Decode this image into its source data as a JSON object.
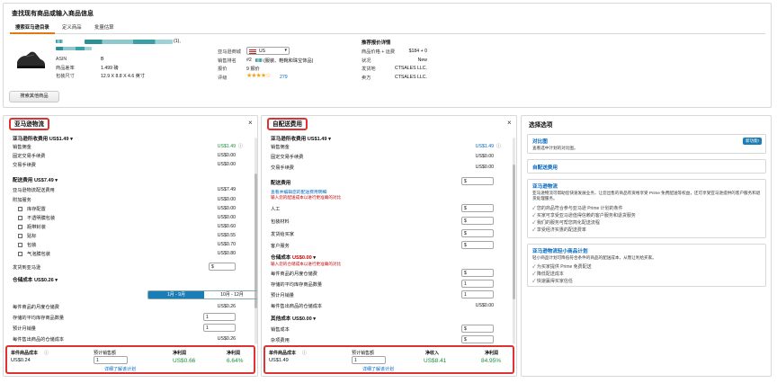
{
  "page_title": "查找现有商品或输入商品信息",
  "tabs": [
    "搜索亚马逊目录",
    "定义商品",
    "批量估算"
  ],
  "product": {
    "title_suffix": "(1),",
    "asin_label": "ASIN",
    "asin_value": "B",
    "category_label": "商品差率",
    "category_value": "1.499 磅",
    "dims_label": "包装尺寸",
    "dims_value": "12.9 X 8.8 X 4.6 英寸",
    "marketplace_label": "亚马逊商城",
    "marketplace_value": "US",
    "rank_label": "销售排名",
    "rank_value": "#2",
    "rank_category": "(服装、鞋靴和珠宝饰品)",
    "offers_label": "报价",
    "offers_value": "9 报价",
    "rating_label": "评级",
    "rating_stars": "★★★★☆",
    "rating_count": "279",
    "search_other": "搜索其他商品"
  },
  "offer": {
    "heading": "推荐报价详情",
    "price_label": "商品价格 + 运费",
    "price_value": "$184 + 0",
    "condition_label": "状况",
    "condition_value": "New",
    "seller_label": "发货地",
    "seller_value": "CTSALES LLC.",
    "buybox_label": "卖方",
    "buybox_value": "CTSALES LLC."
  },
  "fba": {
    "title": "亚马逊物流",
    "fees_title": "亚马逊所收费用",
    "fees_total": "US$1.49",
    "rows1": [
      {
        "label": "销售佣金",
        "value": "US$1.49",
        "info": true
      },
      {
        "label": "固定交易手续费",
        "value": "US$0.00"
      },
      {
        "label": "交易手续费",
        "value": "US$0.00"
      }
    ],
    "ship_title": "配送费用",
    "ship_total": "US$7.49",
    "rows2": [
      {
        "label": "亚马逊物流配送费用",
        "value": "US$7.49"
      },
      {
        "label": "附加服务",
        "value": "US$0.00"
      }
    ],
    "services": [
      {
        "label": "库存配置",
        "value": "US$0.00"
      },
      {
        "label": "不透明膜包装",
        "value": "US$0.00"
      },
      {
        "label": "瓶带封装",
        "value": "US$0.60"
      },
      {
        "label": "贴标",
        "value": "US$0.55"
      },
      {
        "label": "包装",
        "value": "US$0.70"
      },
      {
        "label": "气泡膜包装",
        "value": "US$0.80"
      }
    ],
    "inbound_label": "发货到亚马逊",
    "inbound_value": "$",
    "storage_title": "仓储成本",
    "storage_total": "US$0.26",
    "period_a": "1月 - 9月",
    "period_b": "10月 - 12月",
    "rows3": [
      {
        "label": "每件商品的月度仓储费",
        "value": "US$0.26"
      },
      {
        "label": "存储的平均库存商品数量",
        "value": "1"
      },
      {
        "label": "预计月销量",
        "value": "1"
      },
      {
        "label": "每件售出商品的仓储成本",
        "value": "US$0.26"
      }
    ],
    "footer": {
      "cost_label": "单件商品成本",
      "cost_value": "US$0.24",
      "qty_label": "预计销售额",
      "qty_value": "1",
      "net_label": "净利润",
      "net_value": "US$0.66",
      "margin_label": "净利润",
      "margin_value": "6.64%",
      "more_link": "详细了解该计划"
    }
  },
  "mfn": {
    "title": "自配送费用",
    "fees_title": "亚马逊所收费用",
    "fees_total": "US$1.49",
    "rows1": [
      {
        "label": "销售佣金",
        "value": "US$1.49",
        "info": true
      },
      {
        "label": "固定交易手续费",
        "value": "US$0.00"
      },
      {
        "label": "交易手续费",
        "value": "US$0.00"
      }
    ],
    "ship_title": "配送费用",
    "ship_input": "$",
    "ship_link": "查看并编辑您的配送费用明细",
    "ship_note": "输入您的配送成本以进行更准确的对比",
    "rows2": [
      {
        "label": "人工",
        "value": "$"
      },
      {
        "label": "包装材料",
        "value": "$"
      },
      {
        "label": "发货给买家",
        "value": "$"
      },
      {
        "label": "客户服务",
        "value": "$"
      }
    ],
    "storage_title": "仓储成本",
    "storage_total": "US$0.00",
    "storage_note": "输入您的仓储成本以进行更准确的对比",
    "rows3": [
      {
        "label": "每件商品的月度仓储费",
        "value": "$"
      },
      {
        "label": "存储的平均库存商品数量",
        "value": "1"
      },
      {
        "label": "预计月销量",
        "value": "1"
      },
      {
        "label": "每件售出商品的仓储成本",
        "value": "US$0.00"
      }
    ],
    "other_title": "其他成本",
    "other_total": "US$0.00",
    "rows4": [
      {
        "label": "销售成本",
        "value": "$"
      },
      {
        "label": "杂项费用",
        "value": "$"
      }
    ],
    "footer": {
      "cost_label": "单件商品成本",
      "cost_value": "US$1.49",
      "qty_label": "预计销售额",
      "qty_value": "1",
      "net_label": "净收入",
      "net_value": "US$8.41",
      "margin_label": "净利润",
      "margin_value": "84.95%",
      "more_link": "详细了解该计划"
    }
  },
  "options": {
    "title": "选择选项",
    "compare": {
      "title": "对比图",
      "desc": "查看选中计划的对比图。",
      "badge": "新功能!"
    },
    "mfn_card": {
      "title": "自配送费用"
    },
    "fba_card": {
      "title": "亚马逊物流",
      "desc": "亚马逊物流可帮助您快速发展业务，让您出售的商品有资格享受 Prime 免费配送等权益，还可享受亚马逊提供的客户服务和退货处理服务。",
      "checks": [
        "您的商品符合参与亚马逊 Prime 计划的条件",
        "买家可享受亚马逊值得信赖的客户服务和退货服务",
        "我们的服务可帮您简化配送流程",
        "享受经济实惠的配送费率"
      ]
    },
    "small_card": {
      "title": "亚马逊物流轻小商品计划",
      "desc": "轻小商品计划可降低符合条件的商品的配送成本，从而让利给买家。",
      "checks": [
        "为买家提供 Prime 免费配送",
        "降低配送成本",
        "快速赢得买家信任"
      ]
    }
  },
  "colors": {
    "accent": "#e47911",
    "link": "#0066c0",
    "green": "#188f3a",
    "red": "#c40000",
    "highlight": "#dd3333"
  }
}
